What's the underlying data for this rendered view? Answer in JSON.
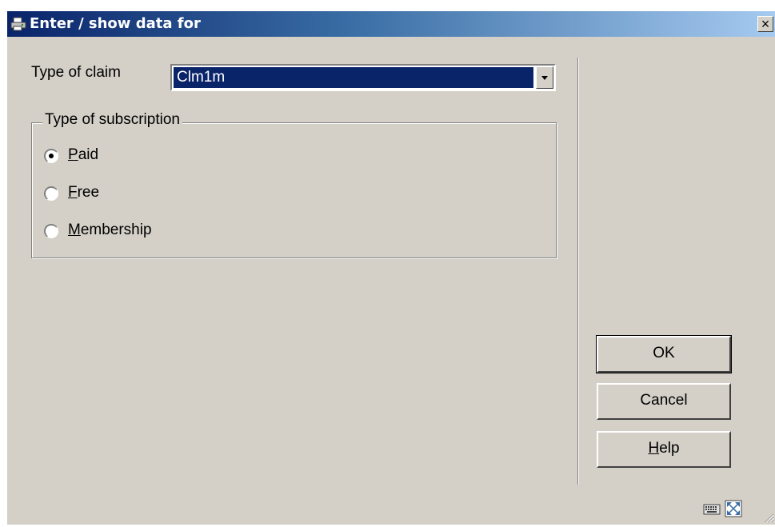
{
  "window": {
    "title": "Enter / show data for",
    "close_symbol": "×"
  },
  "form": {
    "claim_type_label": "Type of claim",
    "claim_type_value": "Clm1m",
    "subscription_group_label": "Type of subscription",
    "subscription_options": [
      {
        "mnemonic": "P",
        "rest": "aid",
        "checked": true
      },
      {
        "mnemonic": "F",
        "rest": "ree",
        "checked": false
      },
      {
        "mnemonic": "M",
        "rest": "embership",
        "checked": false
      }
    ]
  },
  "buttons": {
    "ok": "OK",
    "cancel": "Cancel",
    "help_mnemonic": "H",
    "help_rest": "elp"
  },
  "icons": {
    "title": "printer-app-icon",
    "status_left": "keyboard-icon",
    "status_right": "fullscreen-icon",
    "grip": "resize-grip-icon"
  }
}
